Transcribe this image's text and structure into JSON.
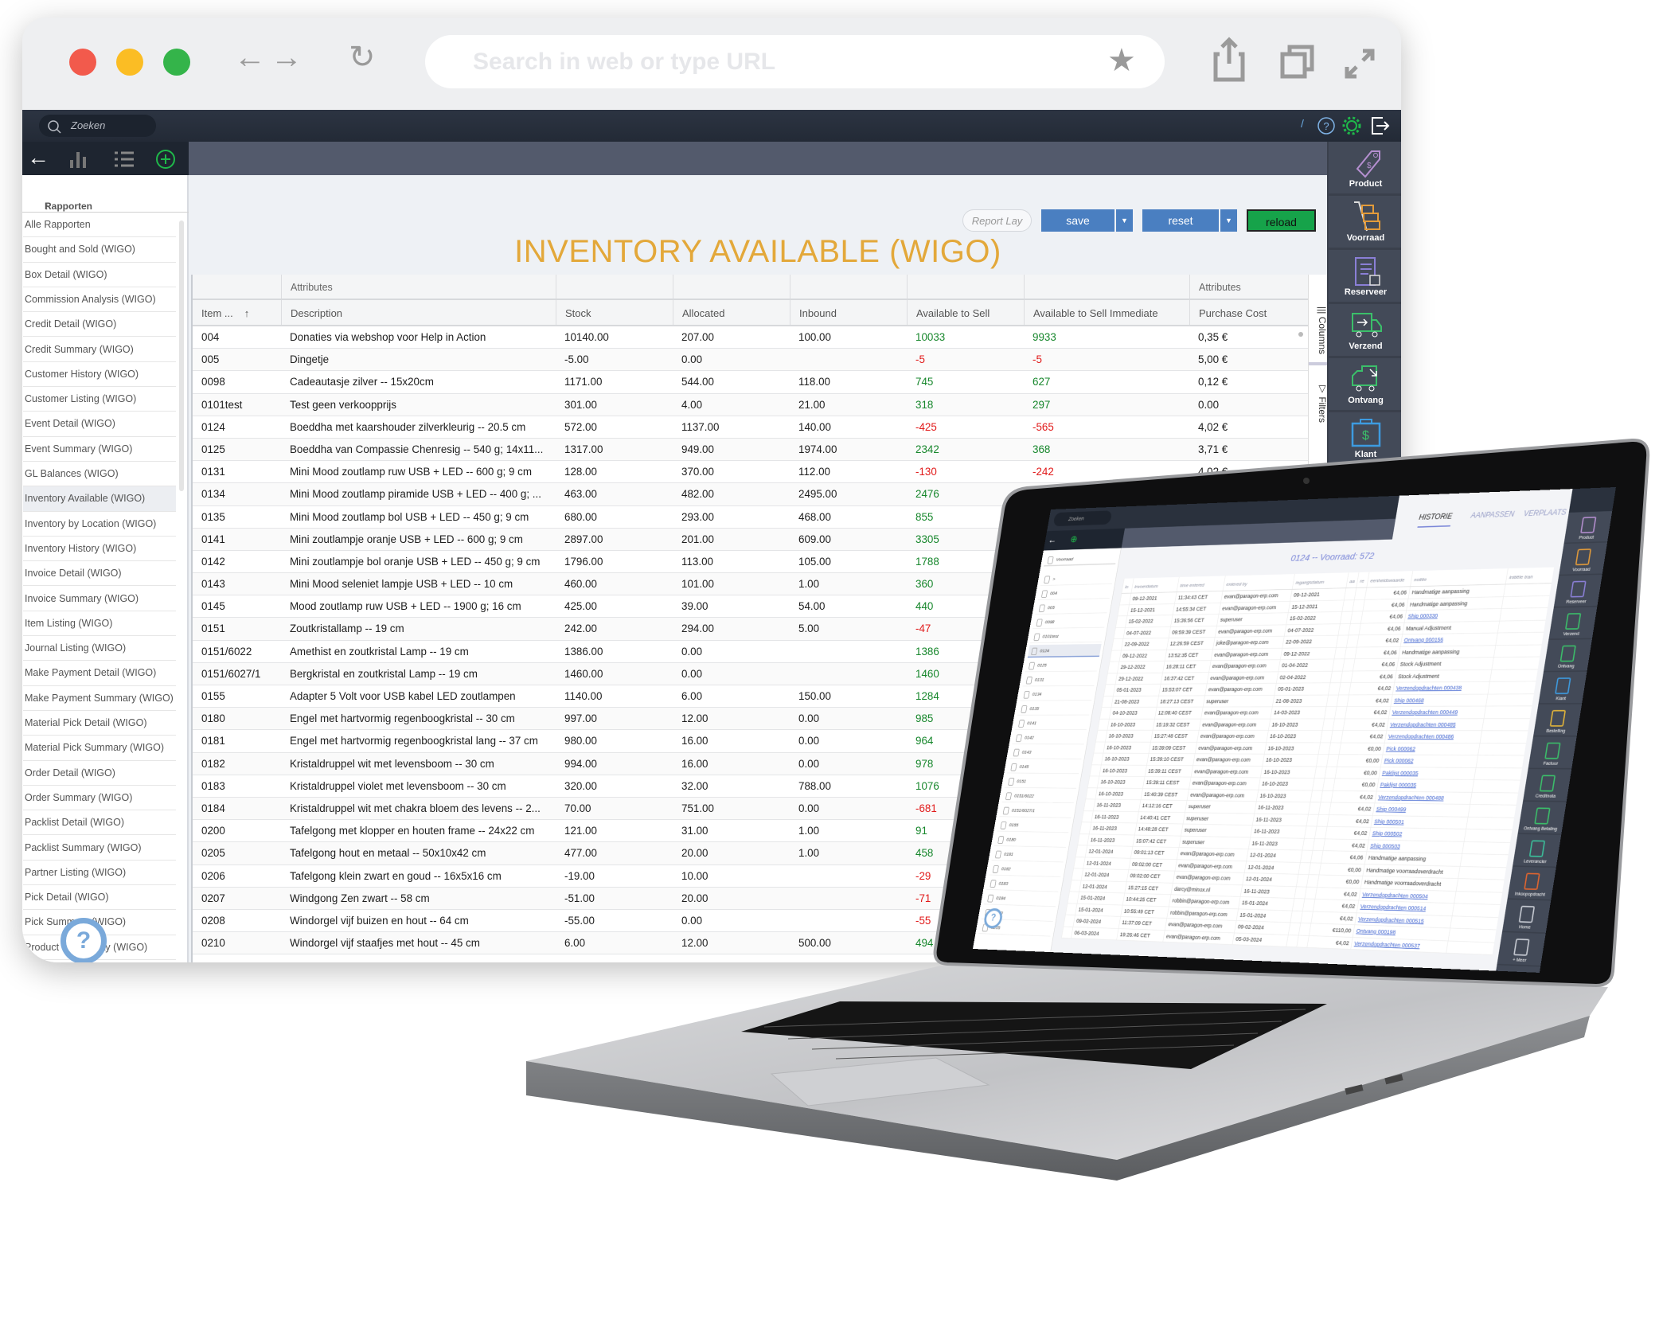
{
  "browser": {
    "url_placeholder": "Search in web or type URL",
    "traffic_lights": [
      "#f25a4c",
      "#fbbd24",
      "#34b44a"
    ]
  },
  "app": {
    "search_placeholder": "Zoeken",
    "topbar_icons": [
      "help-icon",
      "settings-icon",
      "logout-icon"
    ],
    "sidebar": {
      "header": "Rapporten",
      "sort_indicator": "↑",
      "selected": "Inventory Available (WIGO)",
      "items": [
        "Alle Rapporten",
        "Bought and Sold (WIGO)",
        "Box Detail (WIGO)",
        "Commission Analysis (WIGO)",
        "Credit Detail (WIGO)",
        "Credit Summary (WIGO)",
        "Customer History (WIGO)",
        "Customer Listing (WIGO)",
        "Event Detail (WIGO)",
        "Event Summary (WIGO)",
        "GL Balances (WIGO)",
        "Inventory Available (WIGO)",
        "Inventory by Location (WIGO)",
        "Inventory History (WIGO)",
        "Invoice Detail (WIGO)",
        "Invoice Summary (WIGO)",
        "Item Listing (WIGO)",
        "Journal Listing (WIGO)",
        "Make Payment Detail (WIGO)",
        "Make Payment Summary (WIGO)",
        "Material Pick Detail (WIGO)",
        "Material Pick Summary (WIGO)",
        "Order Detail (WIGO)",
        "Order Summary (WIGO)",
        "Packlist Detail (WIGO)",
        "Packlist Summary (WIGO)",
        "Partner Listing (WIGO)",
        "Pick Detail (WIGO)",
        "Pick Summary (WIGO)",
        "Product Profitability (WIGO)"
      ]
    },
    "toolbar": {
      "report_layout_placeholder": "Report Lay",
      "save": "save",
      "reset": "reset",
      "reload": "reload"
    },
    "title": "INVENTORY AVAILABLE (WIGO)",
    "right_nav": [
      {
        "label": "Product",
        "icon": "price-tag-icon",
        "color": "#b58fd0"
      },
      {
        "label": "Voorraad",
        "icon": "hand-truck-icon",
        "color": "#e39b3a"
      },
      {
        "label": "Reserveer",
        "icon": "clipboard-box-icon",
        "color": "#8a7fd6"
      },
      {
        "label": "Verzend",
        "icon": "truck-out-icon",
        "color": "#3bbf6a"
      },
      {
        "label": "Ontvang",
        "icon": "truck-in-icon",
        "color": "#3bbf6a"
      },
      {
        "label": "Klant",
        "icon": "briefcase-dollar-icon",
        "color": "#3d9be0"
      }
    ],
    "side_tabs": {
      "columns": "Columns",
      "filters": "Filters"
    },
    "table": {
      "group_headers": [
        "",
        "Attributes",
        "",
        "",
        "",
        "",
        "",
        "Attributes"
      ],
      "columns": [
        "Item ...",
        "Description",
        "Stock",
        "Allocated",
        "Inbound",
        "Available to Sell",
        "Available to Sell Immediate",
        "Purchase Cost"
      ],
      "sort_indicator": "↑",
      "colors": {
        "positive": "#17872c",
        "negative": "#e11b1b"
      },
      "rows": [
        [
          "004",
          "Donaties via webshop voor Help in Action",
          "10140.00",
          "207.00",
          "100.00",
          "10033",
          "9933",
          "0,35 €"
        ],
        [
          "005",
          "Dingetje",
          "-5.00",
          "0.00",
          "",
          "-5",
          "-5",
          "5,00 €"
        ],
        [
          "0098",
          "Cadeautasje zilver -- 15x20cm",
          "1171.00",
          "544.00",
          "118.00",
          "745",
          "627",
          "0,12 €"
        ],
        [
          "0101test",
          "Test geen verkoopprijs",
          "301.00",
          "4.00",
          "21.00",
          "318",
          "297",
          "0.00"
        ],
        [
          "0124",
          "Boeddha met kaarshouder zilverkleurig -- 20.5 cm",
          "572.00",
          "1137.00",
          "140.00",
          "-425",
          "-565",
          "4,02 €"
        ],
        [
          "0125",
          "Boeddha van Compassie Chenresig -- 540 g; 14x11...",
          "1317.00",
          "949.00",
          "1974.00",
          "2342",
          "368",
          "3,71 €"
        ],
        [
          "0131",
          "Mini Mood zoutlamp ruw USB + LED -- 600 g; 9 cm",
          "128.00",
          "370.00",
          "112.00",
          "-130",
          "-242",
          "4,02 €"
        ],
        [
          "0134",
          "Mini Mood zoutlamp piramide USB + LED -- 400 g; ...",
          "463.00",
          "482.00",
          "2495.00",
          "2476",
          "",
          ""
        ],
        [
          "0135",
          "Mini Mood zoutlamp bol USB + LED -- 450 g; 9 cm",
          "680.00",
          "293.00",
          "468.00",
          "855",
          "",
          ""
        ],
        [
          "0141",
          "Mini zoutlampje oranje USB + LED -- 600 g; 9 cm",
          "2897.00",
          "201.00",
          "609.00",
          "3305",
          "",
          ""
        ],
        [
          "0142",
          "Mini zoutlampje bol oranje USB + LED -- 450 g; 9 cm",
          "1796.00",
          "113.00",
          "105.00",
          "1788",
          "",
          ""
        ],
        [
          "0143",
          "Mini Mood seleniet lampje USB + LED -- 10 cm",
          "460.00",
          "101.00",
          "1.00",
          "360",
          "",
          ""
        ],
        [
          "0145",
          "Mood zoutlamp ruw USB + LED -- 1900 g; 16 cm",
          "425.00",
          "39.00",
          "54.00",
          "440",
          "",
          ""
        ],
        [
          "0151",
          "Zoutkristallamp -- 19 cm",
          "242.00",
          "294.00",
          "5.00",
          "-47",
          "",
          ""
        ],
        [
          "0151/6022",
          "Amethist en zoutkristal Lamp -- 19 cm",
          "1386.00",
          "0.00",
          "",
          "1386",
          "",
          ""
        ],
        [
          "0151/6027/1",
          "Bergkristal en zoutkristal Lamp -- 19 cm",
          "1460.00",
          "0.00",
          "",
          "1460",
          "",
          ""
        ],
        [
          "0155",
          "Adapter 5 Volt voor USB kabel LED zoutlampen",
          "1140.00",
          "6.00",
          "150.00",
          "1284",
          "",
          ""
        ],
        [
          "0180",
          "Engel met hartvormig regenboogkristal -- 30 cm",
          "997.00",
          "12.00",
          "0.00",
          "985",
          "",
          ""
        ],
        [
          "0181",
          "Engel met hartvormig regenboogkristal lang -- 37 cm",
          "980.00",
          "16.00",
          "0.00",
          "964",
          "",
          ""
        ],
        [
          "0182",
          "Kristaldruppel wit met levensboom -- 30 cm",
          "994.00",
          "16.00",
          "0.00",
          "978",
          "",
          ""
        ],
        [
          "0183",
          "Kristaldruppel violet met levensboom -- 30 cm",
          "320.00",
          "32.00",
          "788.00",
          "1076",
          "",
          ""
        ],
        [
          "0184",
          "Kristaldruppel wit met chakra bloem des levens -- 2...",
          "70.00",
          "751.00",
          "0.00",
          "-681",
          "",
          ""
        ],
        [
          "0200",
          "Tafelgong met klopper en houten frame -- 24x22 cm",
          "121.00",
          "31.00",
          "1.00",
          "91",
          "",
          ""
        ],
        [
          "0205",
          "Tafelgong hout en metaal -- 50x10x42 cm",
          "477.00",
          "20.00",
          "1.00",
          "458",
          "",
          ""
        ],
        [
          "0206",
          "Tafelgong klein zwart en goud -- 16x5x16 cm",
          "-19.00",
          "10.00",
          "",
          "-29",
          "",
          ""
        ],
        [
          "0207",
          "Windgong Zen zwart -- 58 cm",
          "-51.00",
          "20.00",
          "",
          "-71",
          "",
          ""
        ],
        [
          "0208",
          "Windorgel vijf buizen en hout -- 64 cm",
          "-55.00",
          "0.00",
          "",
          "-55",
          "",
          ""
        ],
        [
          "0210",
          "Windorgel vijf staafjes met hout -- 45 cm",
          "6.00",
          "12.00",
          "500.00",
          "494",
          "",
          ""
        ]
      ]
    }
  },
  "laptop_screen": {
    "search_placeholder": "Zoeken",
    "tabs": [
      "HISTORIE",
      "AANPASSEN",
      "VERPLAATS"
    ],
    "active_tab": "HISTORIE",
    "title": "0124 -- Voorraad: 572",
    "list_header": "Voorraad",
    "list_items": [
      ">",
      "004",
      "005",
      "0098",
      "0101test",
      "0124",
      "0125",
      "0131",
      "0134",
      "0135",
      "0141",
      "0142",
      "0143",
      "0145",
      "0151",
      "0151/6022",
      "0151/6027/1",
      "0155",
      "0180",
      "0181",
      "0182",
      "0183",
      "0184",
      "0200",
      "0205"
    ],
    "list_selected": "0124",
    "columns": [
      "lo",
      "invoerdatum",
      "time entered",
      "entered by",
      "ingangsdatum",
      "aa",
      "re",
      "eenheidswaarde",
      "notitie",
      "initiële tran"
    ],
    "rows": [
      [
        "09-12-2021",
        "11:34:43 CET",
        "evan@paragon-erp.com",
        "09-12-2021",
        "€4,06",
        "Handmatige aanpassing"
      ],
      [
        "15-12-2021",
        "14:55:34 CET",
        "evan@paragon-erp.com",
        "15-12-2021",
        "€4,06",
        "Handmatige aanpassing"
      ],
      [
        "15-02-2022",
        "15:36:56 CET",
        "superuser",
        "15-02-2022",
        "€4,06",
        "Ship 000330"
      ],
      [
        "04-07-2022",
        "09:59:39 CEST",
        "evan@paragon-erp.com",
        "04-07-2022",
        "€4,06",
        "Manual Adjustment"
      ],
      [
        "22-09-2022",
        "12:26:59 CEST",
        "joke@paragon-erp.com",
        "22-09-2022",
        "€4,02",
        "Ontvang 000156"
      ],
      [
        "09-12-2022",
        "13:52:35 CET",
        "evan@paragon-erp.com",
        "09-12-2022",
        "€4,06",
        "Handmatige aanpassing"
      ],
      [
        "29-12-2022",
        "16:28:11 CET",
        "evan@paragon-erp.com",
        "01-04-2022",
        "€4,06",
        "Stock Adjustment"
      ],
      [
        "29-12-2022",
        "16:37:42 CET",
        "evan@paragon-erp.com",
        "02-04-2022",
        "€4,06",
        "Stock Adjustment"
      ],
      [
        "05-01-2023",
        "15:53:07 CET",
        "evan@paragon-erp.com",
        "05-01-2023",
        "€4,02",
        "Verzendopdrachten 000438"
      ],
      [
        "21-08-2023",
        "18:27:13 CEST",
        "superuser",
        "21-08-2023",
        "€4,02",
        "Ship 000468"
      ],
      [
        "04-10-2023",
        "12:08:40 CEST",
        "evan@paragon-erp.com",
        "14-03-2023",
        "€4,02",
        "Verzendopdrachten 000449"
      ],
      [
        "16-10-2023",
        "15:19:32 CEST",
        "evan@paragon-erp.com",
        "16-10-2023",
        "€4,02",
        "Verzendopdrachten 000485"
      ],
      [
        "16-10-2023",
        "15:27:48 CEST",
        "evan@paragon-erp.com",
        "16-10-2023",
        "€4,02",
        "Verzendopdrachten 000486"
      ],
      [
        "16-10-2023",
        "15:39:09 CEST",
        "evan@paragon-erp.com",
        "16-10-2023",
        "€0,00",
        "Pick 000062"
      ],
      [
        "16-10-2023",
        "15:39:10 CEST",
        "evan@paragon-erp.com",
        "16-10-2023",
        "€0,00",
        "Pick 000062"
      ],
      [
        "16-10-2023",
        "15:39:11 CEST",
        "evan@paragon-erp.com",
        "16-10-2023",
        "€0,00",
        "Paklijst 000035"
      ],
      [
        "16-10-2023",
        "15:39:11 CEST",
        "evan@paragon-erp.com",
        "16-10-2023",
        "€0,00",
        "Paklijst 000035"
      ],
      [
        "16-10-2023",
        "15:40:39 CEST",
        "evan@paragon-erp.com",
        "16-10-2023",
        "€4,02",
        "Verzendopdrachten 000488"
      ],
      [
        "16-11-2023",
        "14:12:16 CET",
        "superuser",
        "16-11-2023",
        "€4,02",
        "Ship 000499"
      ],
      [
        "16-11-2023",
        "14:40:41 CET",
        "superuser",
        "16-11-2023",
        "€4,02",
        "Ship 000501"
      ],
      [
        "16-11-2023",
        "14:48:28 CET",
        "superuser",
        "16-11-2023",
        "€4,02",
        "Ship 000502"
      ],
      [
        "16-11-2023",
        "15:07:42 CET",
        "superuser",
        "16-11-2023",
        "€4,02",
        "Ship 000503"
      ],
      [
        "12-01-2024",
        "09:01:13 CET",
        "evan@paragon-erp.com",
        "12-01-2024",
        "€4,06",
        "Handmatige aanpassing"
      ],
      [
        "12-01-2024",
        "09:02:00 CET",
        "evan@paragon-erp.com",
        "12-01-2024",
        "€0,00",
        "Handmatige voorraadoverdracht"
      ],
      [
        "12-01-2024",
        "09:02:00 CET",
        "evan@paragon-erp.com",
        "12-01-2024",
        "€0,00",
        "Handmatige voorraadoverdracht"
      ],
      [
        "12-01-2024",
        "15:27:15 CET",
        "darcy@minox.nl",
        "16-11-2023",
        "€4,02",
        "Verzendopdrachten 000504"
      ],
      [
        "15-01-2024",
        "10:44:25 CET",
        "robbin@paragon-erp.com",
        "15-01-2024",
        "€4,02",
        "Verzendopdrachten 000514"
      ],
      [
        "15-01-2024",
        "10:55:49 CET",
        "robbin@paragon-erp.com",
        "15-01-2024",
        "€4,02",
        "Verzendopdrachten 000515"
      ],
      [
        "09-02-2024",
        "11:37:09 CET",
        "evan@paragon-erp.com",
        "09-02-2024",
        "€110,00",
        "Ontvang 000198"
      ],
      [
        "06-03-2024",
        "19:26:46 CET",
        "evan@paragon-erp.com",
        "05-03-2024",
        "€4,02",
        "Verzendopdrachten 000537"
      ]
    ],
    "right_nav": [
      {
        "label": "Product",
        "color": "#b58fd0"
      },
      {
        "label": "Voorraad",
        "color": "#e39b3a"
      },
      {
        "label": "Reserveer",
        "color": "#8a7fd6"
      },
      {
        "label": "Verzend",
        "color": "#3bbf6a"
      },
      {
        "label": "Ontvang",
        "color": "#3bbf6a"
      },
      {
        "label": "Klant",
        "color": "#3d9be0"
      },
      {
        "label": "Bestelling",
        "color": "#e3b53a"
      },
      {
        "label": "Factuur",
        "color": "#3bbf6a"
      },
      {
        "label": "Creditnota",
        "color": "#3bbf6a"
      },
      {
        "label": "Ontvang Betaling",
        "color": "#3bbf6a"
      },
      {
        "label": "Leverancier",
        "color": "#3bbf9a"
      },
      {
        "label": "Inkoopopdracht",
        "color": "#e0652f"
      },
      {
        "label": "Home",
        "color": "#c8ccd4"
      },
      {
        "label": "+ Meer",
        "color": "#c8ccd4"
      }
    ]
  }
}
